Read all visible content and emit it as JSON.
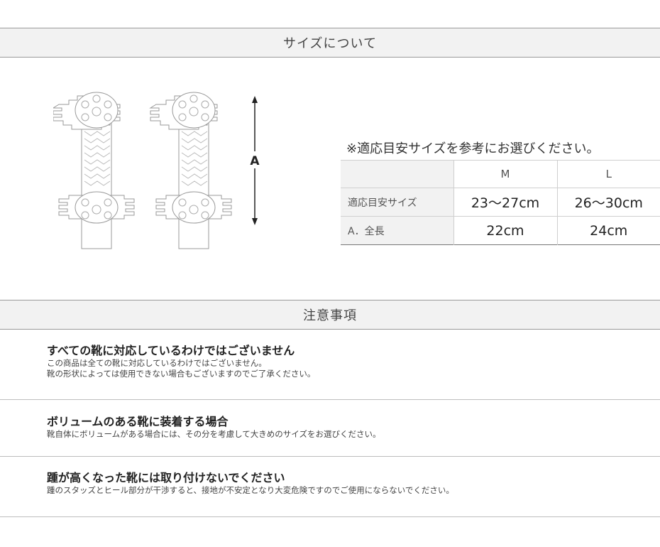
{
  "size_section": {
    "title": "サイズについて"
  },
  "illustration": {
    "dimension_label": "A"
  },
  "size_table": {
    "title": "※適応目安サイズを参考にお選びください。",
    "columns": [
      "M",
      "L"
    ],
    "rows": [
      {
        "label": "適応目安サイズ",
        "values": [
          "23〜27cm",
          "26〜30cm"
        ]
      },
      {
        "label": "A．全長",
        "values": [
          "22cm",
          "24cm"
        ]
      }
    ]
  },
  "notes_section": {
    "title": "注意事項",
    "items": [
      {
        "heading": "すべての靴に対応しているわけではございません",
        "lines": [
          "この商品は全ての靴に対応しているわけではございません。",
          "靴の形状によっては使用できない場合もございますのでご了承ください。"
        ]
      },
      {
        "heading": "ボリュームのある靴に装着する場合",
        "lines": [
          "靴自体にボリュームがある場合には、その分を考慮して大きめのサイズをお選びください。"
        ]
      },
      {
        "heading": "踵が高くなった靴には取り付けないでください",
        "lines": [
          "踵のスタッズとヒール部分が干渉すると、接地が不安定となり大変危険ですのでご使用にならないでください。"
        ]
      }
    ]
  }
}
